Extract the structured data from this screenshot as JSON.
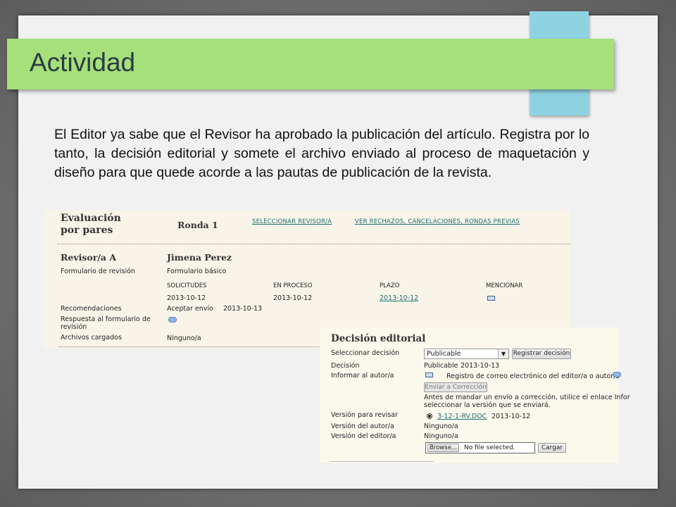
{
  "slide": {
    "title": "Actividad",
    "body": "El Editor ya sabe que el Revisor ha aprobado la publicación del artículo. Registra por lo tanto, la decisión editorial y somete el archivo enviado al proceso de maquetación y diseño para que quede acorde a las pautas de publicación de la revista."
  },
  "peer_review": {
    "heading_line1": "Evaluación",
    "heading_line2": "por pares",
    "round": "Ronda 1",
    "link_select_reviewer": "SELECCIONAR REVISOR/A",
    "link_rejections": "VER RECHAZOS, CANCELACIONES, RONDAS PREVIAS",
    "reviewer_label": "Revisor/a A",
    "reviewer_name": "Jimena Perez",
    "form_label": "Formulario de revisión",
    "form_value": "Formulario básico",
    "col_requests": "SOLICITUDES",
    "col_in_process": "EN PROCESO",
    "col_deadline": "PLAZO",
    "col_mention": "MENCIONAR",
    "date_requests": "2013-10-12",
    "date_in_process": "2013-10-12",
    "date_deadline": "2013-10-12",
    "recommendations_label": "Recomendaciones",
    "recommendation_value": "Aceptar envío",
    "recommendation_date": "2013-10-13",
    "response_label": "Respuesta al formulario de revisión",
    "files_label": "Archivos cargados",
    "files_value": "Ninguno/a"
  },
  "decision": {
    "heading": "Decisión editorial",
    "select_label": "Seleccionar decisión",
    "select_value": "Publicable",
    "register_button": "Registrar decisión",
    "decision_label": "Decisión",
    "decision_value": "Publicable",
    "decision_date": "2013-10-13",
    "inform_label": "Informar al autor/a",
    "inform_text": "Registro de correo electrónico del editor/a o autor/a",
    "send_correction_button": "Enviar a Corrección",
    "note_line1": "Antes de mandar un envío a corrección, utilice el enlace Infor",
    "note_line2": "seleccionar la versión que se enviará.",
    "review_version_label": "Versión para revisar",
    "review_version_file": "3-12-1-RV.DOC",
    "review_version_date": "2013-10-12",
    "author_version_label": "Versión del autor/a",
    "author_version_value": "Ninguno/a",
    "editor_version_label": "Versión del editor/a",
    "editor_version_value": "Ninguno/a",
    "browse_button": "Browse...",
    "no_file_text": "No file selected.",
    "upload_button": "Cargar"
  },
  "colors": {
    "title_bar": "#a5e07b",
    "tab_decoration": "#8fd3e3",
    "slide_background": "#f1f1f1",
    "link": "#1f6e74"
  }
}
